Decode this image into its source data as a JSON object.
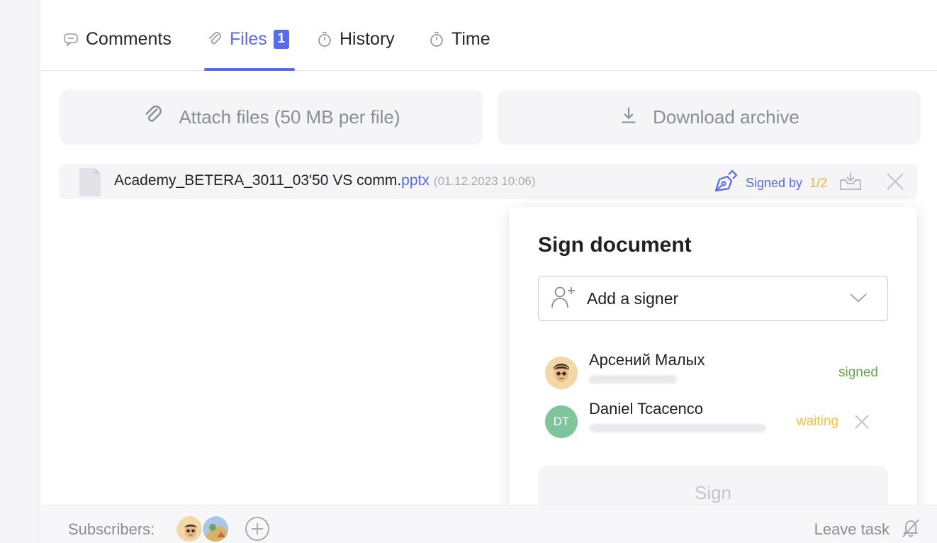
{
  "tabs": [
    {
      "label": "Comments",
      "icon": "comment-icon",
      "active": false
    },
    {
      "label": "Files",
      "icon": "paperclip-icon",
      "active": true,
      "badge": "1"
    },
    {
      "label": "History",
      "icon": "stopwatch-icon",
      "active": false
    },
    {
      "label": "Time",
      "icon": "stopwatch-icon",
      "active": false
    }
  ],
  "actions": {
    "attach_label": "Attach files (50 MB per file)",
    "download_label": "Download archive"
  },
  "file": {
    "name": "Academy_BETERA_3011_03'50 VS comm.",
    "ext": "pptx",
    "date": "(01.12.2023 10:06)",
    "signed_by_label": "Signed by",
    "signed_count": "1/2"
  },
  "sign_popup": {
    "title": "Sign document",
    "select_placeholder": "Add a signer",
    "signers": [
      {
        "name": "Арсений Малых",
        "status": "signed"
      },
      {
        "name": "Daniel Tcacenco",
        "initials": "DT",
        "status": "waiting"
      }
    ],
    "sign_button": "Sign"
  },
  "footer": {
    "subscribers_label": "Subscribers:",
    "leave_task_label": "Leave task"
  },
  "colors": {
    "accent": "#5a6be8",
    "signed": "#6aa84f",
    "waiting": "#f0c040",
    "count": "#f0b429"
  }
}
